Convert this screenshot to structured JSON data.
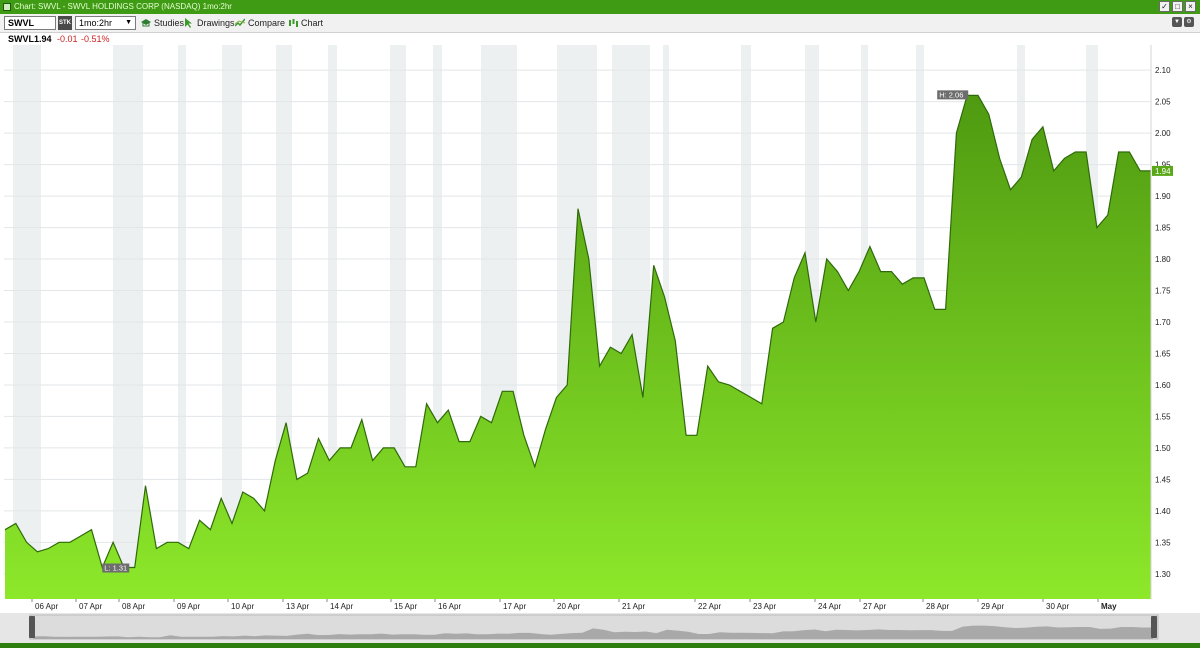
{
  "window": {
    "title": "Chart: SWVL - SWVL HOLDINGS CORP (NASDAQ) 1mo:2hr",
    "buttons": [
      "✓",
      "□",
      "×"
    ]
  },
  "toolbar": {
    "symbol": "SWVL",
    "type_badge": "STK",
    "period": "1mo:2hr",
    "studies": "Studies",
    "drawings": "Drawings",
    "compare": "Compare",
    "chart": "Chart"
  },
  "quote": {
    "symbol": "SWVL",
    "price": "1.94",
    "change": "-0.01",
    "change_pct": "-0.51%",
    "change_color": "#cc2222"
  },
  "chart_data": {
    "type": "area",
    "title": "",
    "ylim": [
      1.26,
      2.14
    ],
    "y_ticks": [
      "2.10",
      "2.05",
      "2.00",
      "1.95",
      "1.90",
      "1.85",
      "1.80",
      "1.75",
      "1.70",
      "1.65",
      "1.60",
      "1.55",
      "1.50",
      "1.45",
      "1.40",
      "1.35",
      "1.30"
    ],
    "x_labels": [
      "06 Apr",
      "07 Apr",
      "08 Apr",
      "09 Apr",
      "10 Apr",
      "13 Apr",
      "14 Apr",
      "15 Apr",
      "16 Apr",
      "17 Apr",
      "20 Apr",
      "21 Apr",
      "22 Apr",
      "23 Apr",
      "24 Apr",
      "27 Apr",
      "28 Apr",
      "29 Apr",
      "30 Apr",
      "May"
    ],
    "values": [
      1.37,
      1.38,
      1.35,
      1.335,
      1.34,
      1.35,
      1.35,
      1.36,
      1.37,
      1.31,
      1.35,
      1.31,
      1.31,
      1.44,
      1.34,
      1.35,
      1.35,
      1.34,
      1.385,
      1.37,
      1.42,
      1.38,
      1.43,
      1.42,
      1.4,
      1.48,
      1.54,
      1.45,
      1.46,
      1.515,
      1.48,
      1.5,
      1.5,
      1.545,
      1.48,
      1.5,
      1.5,
      1.47,
      1.47,
      1.57,
      1.54,
      1.56,
      1.51,
      1.51,
      1.55,
      1.54,
      1.59,
      1.59,
      1.52,
      1.47,
      1.53,
      1.58,
      1.6,
      1.88,
      1.8,
      1.63,
      1.66,
      1.65,
      1.68,
      1.58,
      1.79,
      1.74,
      1.67,
      1.52,
      1.52,
      1.63,
      1.605,
      1.6,
      1.59,
      1.58,
      1.57,
      1.69,
      1.7,
      1.77,
      1.81,
      1.7,
      1.8,
      1.78,
      1.75,
      1.78,
      1.82,
      1.78,
      1.78,
      1.76,
      1.77,
      1.77,
      1.72,
      1.72,
      2.0,
      2.06,
      2.06,
      2.03,
      1.96,
      1.91,
      1.93,
      1.99,
      2.01,
      1.94,
      1.96,
      1.97,
      1.97,
      1.85,
      1.87,
      1.97,
      1.97,
      1.94,
      1.94
    ],
    "last_value": "1.94",
    "high_label": "H: 2.06",
    "low_label": "L: 1.31",
    "colors": {
      "fill_top": "#4f9a11",
      "fill_bottom": "#8de82a",
      "line": "#2f6a0a",
      "last_tag": "#5aa81a"
    }
  }
}
